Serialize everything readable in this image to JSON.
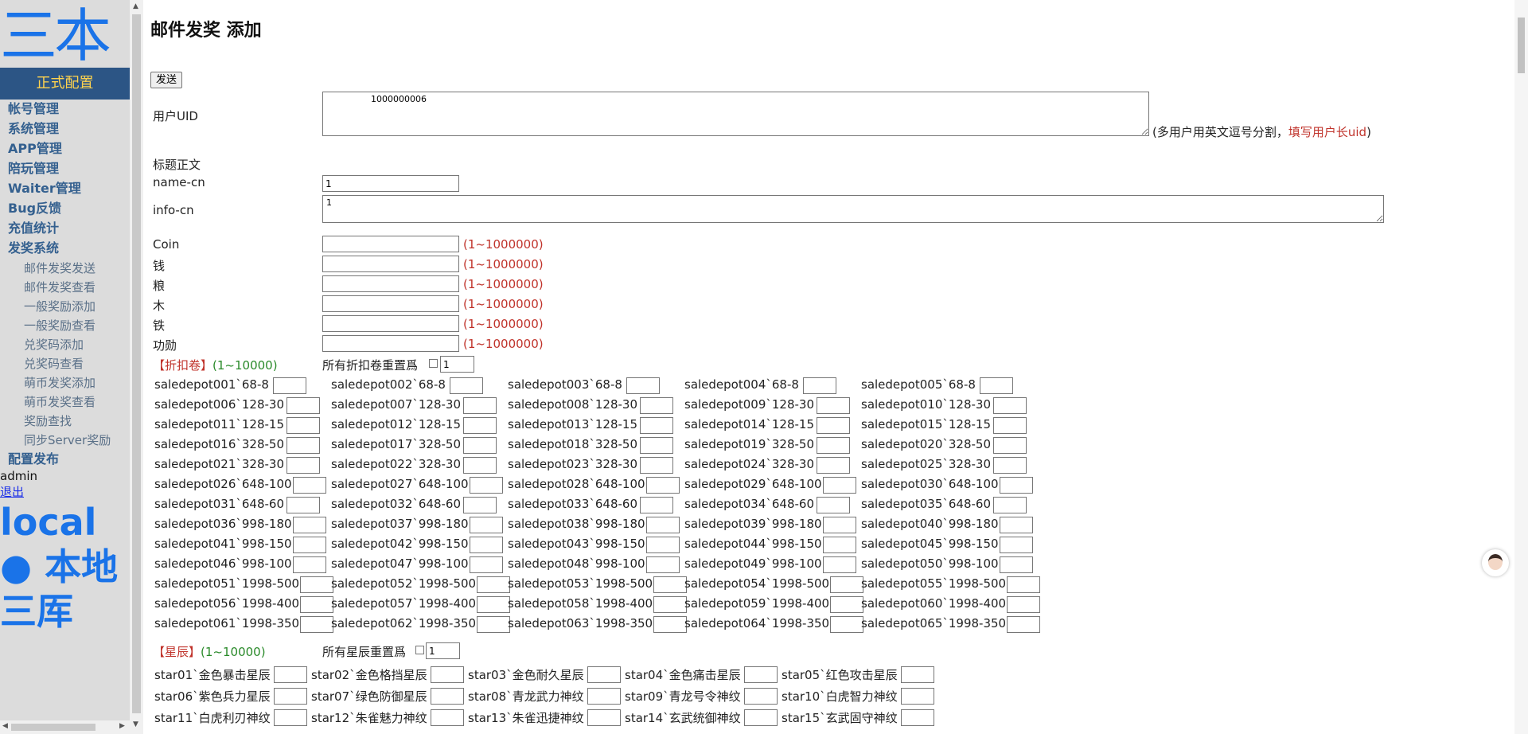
{
  "sidebar": {
    "logo": "三本",
    "config_banner": "正式配置",
    "menu": [
      {
        "label": "帐号管理",
        "level": "top"
      },
      {
        "label": "系统管理",
        "level": "top"
      },
      {
        "label": "APP管理",
        "level": "top"
      },
      {
        "label": "陪玩管理",
        "level": "top"
      },
      {
        "label": "Waiter管理",
        "level": "top"
      },
      {
        "label": "Bug反馈",
        "level": "top"
      },
      {
        "label": "充值统计",
        "level": "top"
      },
      {
        "label": "发奖系统",
        "level": "top"
      },
      {
        "label": "邮件发奖发送",
        "level": "sub"
      },
      {
        "label": "邮件发奖查看",
        "level": "sub"
      },
      {
        "label": "一般奖励添加",
        "level": "sub"
      },
      {
        "label": "一般奖励查看",
        "level": "sub"
      },
      {
        "label": "兑奖码添加",
        "level": "sub"
      },
      {
        "label": "兑奖码查看",
        "level": "sub"
      },
      {
        "label": "萌币发奖添加",
        "level": "sub"
      },
      {
        "label": "萌币发奖查看",
        "level": "sub"
      },
      {
        "label": "奖励查找",
        "level": "sub"
      },
      {
        "label": "同步Server奖励",
        "level": "sub"
      },
      {
        "label": "配置发布",
        "level": "top"
      }
    ],
    "user": "admin",
    "logout": "退出",
    "env_label": "local ● 本地三",
    "env_extra": "厍"
  },
  "main": {
    "title": "邮件发奖 添加",
    "send_button": "发送",
    "uid_label": "用户UID",
    "uid_value": "                1000000006",
    "uid_hint_a": "(多用户用英文逗号分割，",
    "uid_hint_b": "填写用户长uid",
    "uid_hint_c": ")",
    "section_title_body": "标题正文",
    "name_cn_label": "name-cn",
    "name_cn_value": "1",
    "info_cn_label": "info-cn",
    "info_cn_value": "1",
    "resources": [
      {
        "label": "Coin",
        "hint": "(1~1000000)"
      },
      {
        "label": "钱",
        "hint": "(1~1000000)"
      },
      {
        "label": "粮",
        "hint": "(1~1000000)"
      },
      {
        "label": "木",
        "hint": "(1~1000000)"
      },
      {
        "label": "铁",
        "hint": "(1~1000000)"
      },
      {
        "label": "功勋",
        "hint": "(1~1000000)"
      }
    ],
    "discount": {
      "title": "【折扣卷】",
      "range": "(1~10000)",
      "reset_label": "所有折扣卷重置爲",
      "reset_value": "1",
      "items": [
        "saledepot001`68-8",
        "saledepot002`68-8",
        "saledepot003`68-8",
        "saledepot004`68-8",
        "saledepot005`68-8",
        "saledepot006`128-30",
        "saledepot007`128-30",
        "saledepot008`128-30",
        "saledepot009`128-30",
        "saledepot010`128-30",
        "saledepot011`128-15",
        "saledepot012`128-15",
        "saledepot013`128-15",
        "saledepot014`128-15",
        "saledepot015`128-15",
        "saledepot016`328-50",
        "saledepot017`328-50",
        "saledepot018`328-50",
        "saledepot019`328-50",
        "saledepot020`328-50",
        "saledepot021`328-30",
        "saledepot022`328-30",
        "saledepot023`328-30",
        "saledepot024`328-30",
        "saledepot025`328-30",
        "saledepot026`648-100",
        "saledepot027`648-100",
        "saledepot028`648-100",
        "saledepot029`648-100",
        "saledepot030`648-100",
        "saledepot031`648-60",
        "saledepot032`648-60",
        "saledepot033`648-60",
        "saledepot034`648-60",
        "saledepot035`648-60",
        "saledepot036`998-180",
        "saledepot037`998-180",
        "saledepot038`998-180",
        "saledepot039`998-180",
        "saledepot040`998-180",
        "saledepot041`998-150",
        "saledepot042`998-150",
        "saledepot043`998-150",
        "saledepot044`998-150",
        "saledepot045`998-150",
        "saledepot046`998-100",
        "saledepot047`998-100",
        "saledepot048`998-100",
        "saledepot049`998-100",
        "saledepot050`998-100",
        "saledepot051`1998-500",
        "saledepot052`1998-500",
        "saledepot053`1998-500",
        "saledepot054`1998-500",
        "saledepot055`1998-500",
        "saledepot056`1998-400",
        "saledepot057`1998-400",
        "saledepot058`1998-400",
        "saledepot059`1998-400",
        "saledepot060`1998-400",
        "saledepot061`1998-350",
        "saledepot062`1998-350",
        "saledepot063`1998-350",
        "saledepot064`1998-350",
        "saledepot065`1998-350"
      ]
    },
    "stars": {
      "title": "【星辰】",
      "range": "(1~10000)",
      "reset_label": "所有星辰重置爲",
      "reset_value": "1",
      "items": [
        "star01`金色暴击星辰",
        "star02`金色格挡星辰",
        "star03`金色耐久星辰",
        "star04`金色痛击星辰",
        "star05`红色攻击星辰",
        "star06`紫色兵力星辰",
        "star07`绿色防御星辰",
        "star08`青龙武力神纹",
        "star09`青龙号令神纹",
        "star10`白虎智力神纹",
        "star11`白虎利刃神纹",
        "star12`朱雀魅力神纹",
        "star13`朱雀迅捷神纹",
        "star14`玄武统御神纹",
        "star15`玄武固守神纹"
      ]
    }
  },
  "colors": {
    "accent": "#1a73e8",
    "banner": "#2c5585",
    "hint_red": "#c0332b",
    "hint_green": "#2a8a2a"
  }
}
